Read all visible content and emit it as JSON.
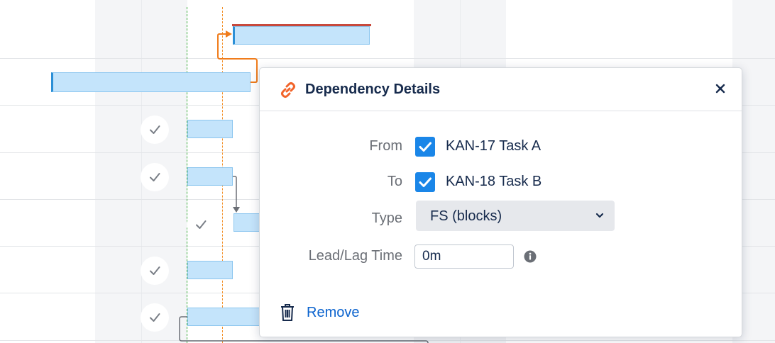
{
  "dialog": {
    "title": "Dependency Details",
    "from_label": "From",
    "from_value": "KAN-17 Task A",
    "to_label": "To",
    "to_value": "KAN-18 Task B",
    "type_label": "Type",
    "type_value": "FS (blocks)",
    "lag_label": "Lead/Lag Time",
    "lag_value": "0m",
    "remove_label": "Remove",
    "icons": {
      "title": "link-icon",
      "close": "close-icon",
      "type_dropdown": "chevron-down-icon",
      "lag_info": "info-icon",
      "remove": "trash-icon"
    }
  },
  "gantt": {
    "task_rows_completed": [
      false,
      false,
      true,
      true,
      true,
      true,
      true
    ],
    "colors": {
      "bar_fill": "#c4e4fb",
      "bar_border": "#8cc6ef",
      "today_line": "#3fae3f",
      "marker_line": "#f3912a",
      "critical": "#c8493c",
      "checkbox": "#1a86e8",
      "link": "#0b63ce"
    }
  }
}
